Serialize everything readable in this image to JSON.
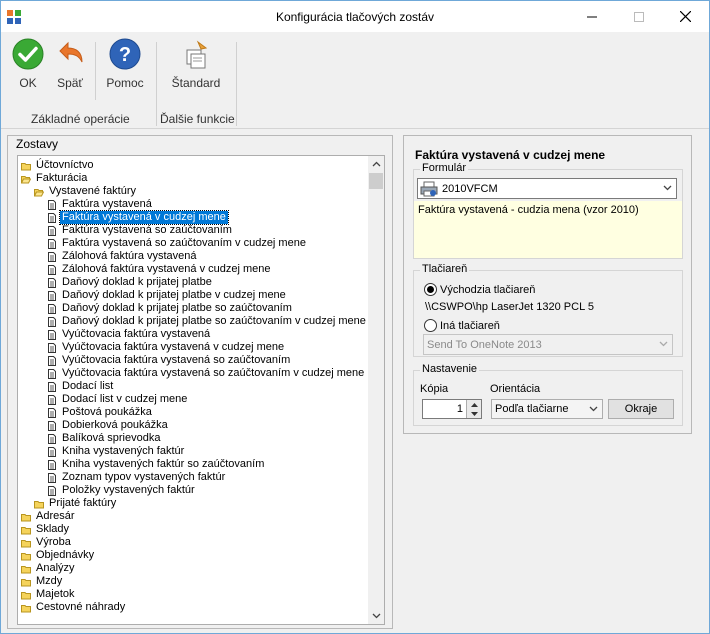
{
  "window": {
    "title": "Konfigurácia tlačových zostáv"
  },
  "ribbon": {
    "ok_label": "OK",
    "back_label": "Späť",
    "help_label": "Pomoc",
    "standard_label": "Štandard",
    "group_basic": "Základné operácie",
    "group_more": "Ďalšie funkcie"
  },
  "tree": {
    "label": "Zostavy",
    "items": [
      {
        "label": "Účtovníctvo",
        "level": 0,
        "kind": "folder"
      },
      {
        "label": "Fakturácia",
        "level": 0,
        "kind": "folder-open"
      },
      {
        "label": "Vystavené faktúry",
        "level": 1,
        "kind": "folder-open"
      },
      {
        "label": "Faktúra vystavená",
        "level": 2,
        "kind": "doc"
      },
      {
        "label": "Faktúra vystavená v cudzej mene",
        "level": 2,
        "kind": "doc",
        "selected": true
      },
      {
        "label": "Faktúra vystavená so zaúčtovaním",
        "level": 2,
        "kind": "doc"
      },
      {
        "label": "Faktúra vystavená so zaúčtovaním v cudzej mene",
        "level": 2,
        "kind": "doc"
      },
      {
        "label": "Zálohová faktúra vystavená",
        "level": 2,
        "kind": "doc"
      },
      {
        "label": "Zálohová faktúra vystavená v cudzej mene",
        "level": 2,
        "kind": "doc"
      },
      {
        "label": "Daňový doklad k prijatej platbe",
        "level": 2,
        "kind": "doc"
      },
      {
        "label": "Daňový doklad k prijatej platbe v cudzej mene",
        "level": 2,
        "kind": "doc"
      },
      {
        "label": "Daňový doklad k prijatej platbe so zaúčtovaním",
        "level": 2,
        "kind": "doc"
      },
      {
        "label": "Daňový doklad k prijatej platbe so zaúčtovaním v cudzej mene",
        "level": 2,
        "kind": "doc"
      },
      {
        "label": "Vyúčtovacia faktúra vystavená",
        "level": 2,
        "kind": "doc"
      },
      {
        "label": "Vyúčtovacia faktúra vystavená v cudzej mene",
        "level": 2,
        "kind": "doc"
      },
      {
        "label": "Vyúčtovacia faktúra vystavená so zaúčtovaním",
        "level": 2,
        "kind": "doc"
      },
      {
        "label": "Vyúčtovacia faktúra vystavená so zaúčtovaním v cudzej mene",
        "level": 2,
        "kind": "doc"
      },
      {
        "label": "Dodací list",
        "level": 2,
        "kind": "doc"
      },
      {
        "label": "Dodací list v cudzej mene",
        "level": 2,
        "kind": "doc"
      },
      {
        "label": "Poštová poukážka",
        "level": 2,
        "kind": "doc"
      },
      {
        "label": "Dobierková poukážka",
        "level": 2,
        "kind": "doc"
      },
      {
        "label": "Balíková sprievodka",
        "level": 2,
        "kind": "doc"
      },
      {
        "label": "Kniha vystavených faktúr",
        "level": 2,
        "kind": "doc"
      },
      {
        "label": "Kniha vystavených faktúr so zaúčtovaním",
        "level": 2,
        "kind": "doc"
      },
      {
        "label": "Zoznam typov vystavených faktúr",
        "level": 2,
        "kind": "doc"
      },
      {
        "label": "Položky vystavených faktúr",
        "level": 2,
        "kind": "doc"
      },
      {
        "label": "Prijaté faktúry",
        "level": 1,
        "kind": "folder"
      },
      {
        "label": "Adresár",
        "level": 0,
        "kind": "folder"
      },
      {
        "label": "Sklady",
        "level": 0,
        "kind": "folder"
      },
      {
        "label": "Výroba",
        "level": 0,
        "kind": "folder"
      },
      {
        "label": "Objednávky",
        "level": 0,
        "kind": "folder"
      },
      {
        "label": "Analýzy",
        "level": 0,
        "kind": "folder"
      },
      {
        "label": "Mzdy",
        "level": 0,
        "kind": "folder"
      },
      {
        "label": "Majetok",
        "level": 0,
        "kind": "folder"
      },
      {
        "label": "Cestovné náhrady",
        "level": 0,
        "kind": "folder"
      }
    ]
  },
  "detail": {
    "title": "Faktúra vystavená v cudzej mene",
    "form_group": "Formulár",
    "form_value": "2010VFCM",
    "form_description": "Faktúra vystavená - cudzia mena (vzor 2010)",
    "printers_group": "Tlačiareň",
    "default_printer_label": "Východzia tlačiareň",
    "default_printer_name": "\\\\CSWPO\\hp LaserJet 1320 PCL 5",
    "other_printer_label": "Iná tlačiareň",
    "other_printer_value": "Send To OneNote 2013",
    "settings_group": "Nastavenie",
    "copies_label": "Kópia",
    "copies_value": "1",
    "orientation_label": "Orientácia",
    "orientation_value": "Podľa tlačiarne",
    "margins_button": "Okraje"
  },
  "colors": {
    "selection": "#0078d7",
    "info_background": "#ffffe1",
    "ok_green": "#3aa935",
    "help_blue": "#2f64b8",
    "back_orange": "#e9762b"
  },
  "icons": {
    "app": "app-icon",
    "ok": "check-circle-icon",
    "back": "undo-arrow-icon",
    "help": "question-circle-icon",
    "standard": "reset-documents-icon",
    "printer": "printer-icon"
  }
}
